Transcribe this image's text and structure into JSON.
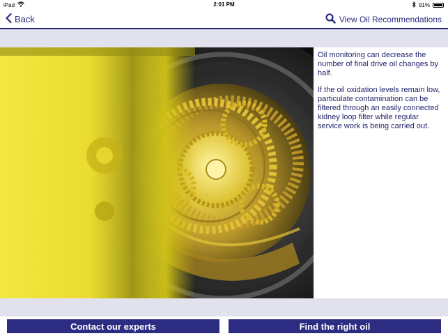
{
  "status_bar": {
    "device": "iPad",
    "time": "2:01 PM",
    "battery": "91%"
  },
  "nav": {
    "back_label": "Back",
    "view_label": "View Oil Recommendations"
  },
  "content": {
    "paragraphs": [
      "Oil monitoring can decrease the number of final drive oil changes by half.",
      "If the oil oxidation levels remain low, particulate contamination can be filtered through an easily connected kidney loop filter while regular service work is being carried out."
    ]
  },
  "actions": {
    "contact_label": "Contact our experts",
    "find_label": "Find the right oil"
  },
  "colors": {
    "accent": "#2c2c82",
    "text": "#22246c",
    "band": "#e2e2ee",
    "highlight": "#f0e000"
  },
  "icons": {
    "back": "chevron-left-icon",
    "search": "search-icon",
    "wifi": "wifi-icon",
    "bluetooth": "bluetooth-icon",
    "battery": "battery-icon"
  }
}
